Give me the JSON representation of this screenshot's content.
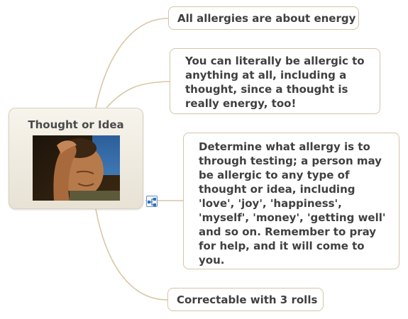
{
  "central": {
    "title": "Thought or Idea",
    "image_icon": "photo-man-holding-head"
  },
  "topics": [
    {
      "text": "All allergies are about energy"
    },
    {
      "text": "You can literally be allergic to\nanything at all, including a\nthought, since a thought is\nreally energy, too!"
    },
    {
      "text": "Determine what allergy is to\nthrough testing; a person may\nbe allergic to any type of\nthought or idea, including\n'love', 'joy', 'happiness',\n'myself', 'money', 'getting well'\nand so on. Remember to pray\nfor help, and it will come to\nyou."
    },
    {
      "text": "Correctable with 3 rolls"
    }
  ],
  "expander_icon": "map-expand-icon",
  "colors": {
    "connector": "#d9c6a5",
    "node_border": "#d5c4a8",
    "central_fill": "#ebe6da",
    "text": "#404040"
  }
}
